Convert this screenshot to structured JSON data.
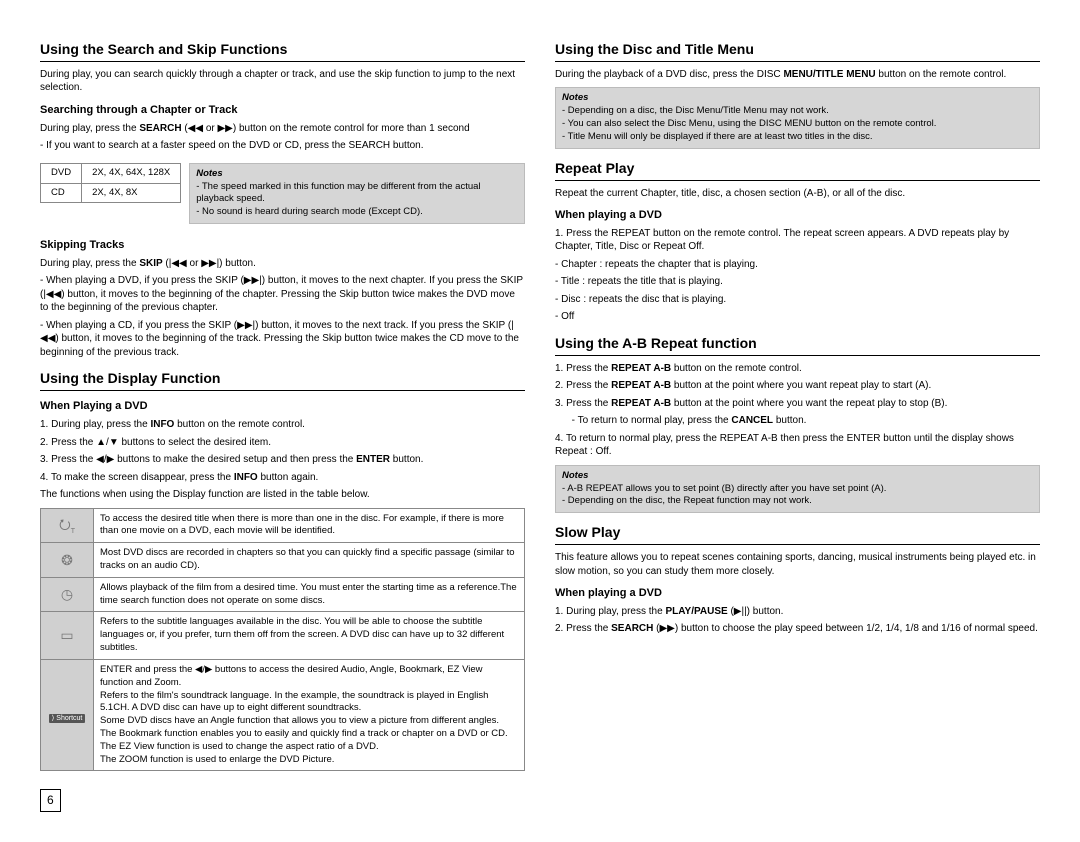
{
  "left": {
    "section1": {
      "title": "Using the Search and Skip Functions",
      "intro": "During play, you can search quickly through a chapter or track, and use the skip function to jump to the next selection.",
      "sub1": "Searching through a Chapter or Track",
      "sub1_p1a": "During play, press the ",
      "sub1_p1b": "SEARCH",
      "sub1_p1c": " (◀◀ or ▶▶) button on the remote control for more than 1 second",
      "sub1_p2": "- If you want to search at a faster speed on the DVD or CD, press the SEARCH button.",
      "speed_table": {
        "r1c1": "DVD",
        "r1c2": "2X, 4X, 64X, 128X",
        "r2c1": "CD",
        "r2c2": "2X, 4X, 8X"
      },
      "notes1": {
        "title": "Notes",
        "l1": "- The speed marked in this function may be different from the actual playback speed.",
        "l2": "- No sound is heard during search mode (Except CD)."
      },
      "sub2": "Skipping Tracks",
      "sub2_p1a": "During play, press the ",
      "sub2_p1b": "SKIP",
      "sub2_p1c": " (|◀◀ or ▶▶|) button.",
      "sub2_p2": "- When playing a DVD, if you press the SKIP (▶▶|) button, it moves to the next chapter. If you press the SKIP (|◀◀) button, it moves to the beginning of the chapter. Pressing the Skip button twice makes the DVD move to the beginning of the previous chapter.",
      "sub2_p3": "- When playing a CD, if you press the SKIP (▶▶|) button, it  moves to the next track. If you press the SKIP (|◀◀) button, it moves to the beginning of the track. Pressing the Skip button twice makes the CD move to the beginning of the previous track."
    },
    "section2": {
      "title": "Using the Display Function",
      "sub1": "When Playing a DVD",
      "l1a": "1. During play, press the ",
      "l1b": "INFO",
      "l1c": " button on the remote control.",
      "l2": "2. Press the ▲/▼ buttons to select the desired item.",
      "l3a": "3. Press the  ◀/▶ buttons to make the desired setup and then press the ",
      "l3b": "ENTER",
      "l3c": " button.",
      "l4a": "4. To make the screen disappear, press the ",
      "l4b": "INFO",
      "l4c": " button again.",
      "funcs_intro": "The functions when using the Display function are listed in the table below.",
      "table": {
        "r1": "To access the desired title when there is more than one in the disc. For example, if there is more than one movie on a DVD, each movie will be identified.",
        "r2": "Most DVD discs are recorded in chapters so that you can quickly find a specific passage (similar to tracks on an audio CD).",
        "r3": "Allows playback of the film from a desired time. You must enter the starting time as a reference.The time search function does not operate on some discs.",
        "r4": "Refers to the subtitle languages available in the disc. You will be able to choose the subtitle languages or, if you prefer, turn them off from the screen. A DVD disc can have up to 32 different subtitles.",
        "r5": "ENTER and press the  ◀/▶  buttons to access the desired Audio, Angle, Bookmark, EZ View function and Zoom.\nRefers to the film's soundtrack language. In the example, the soundtrack is played in English 5.1CH. A DVD disc can have up to eight different soundtracks.\nSome DVD discs have an Angle function that allows you to view a picture from different angles.\nThe Bookmark function enables you to easily and quickly find a track or chapter on a DVD or CD.\nThe EZ View function is used to change the aspect ratio of a DVD.\nThe ZOOM function is used to enlarge the DVD Picture."
      }
    }
  },
  "right": {
    "section1": {
      "title": "Using the Disc and Title Menu",
      "intro_a": "During the playback of a DVD disc, press the DISC ",
      "intro_b": "MENU/TITLE MENU",
      "intro_c": " button on the remote control.",
      "notes": {
        "title": "Notes",
        "l1": "- Depending on a disc, the Disc Menu/Title Menu may not work.",
        "l2": "- You can also select the Disc Menu, using the DISC MENU button on the remote control.",
        "l3": "- Title Menu will only be displayed if there are at least two titles in the disc."
      }
    },
    "section2": {
      "title": "Repeat  Play",
      "intro": "Repeat the current Chapter, title, disc, a chosen section (A-B), or all of the disc.",
      "sub1": "When playing a DVD",
      "l1": "1. Press the REPEAT button on the remote control. The repeat screen appears. A DVD repeats play by Chapter, Title, Disc or Repeat Off.",
      "l2": "- Chapter : repeats the chapter that is playing.",
      "l3": "- Title : repeats the title that is playing.",
      "l4": "- Disc : repeats the disc that is playing.",
      "l5": "- Off"
    },
    "section3": {
      "title": "Using the A-B Repeat function",
      "l1a": "1. Press the ",
      "l1b": "REPEAT A-B",
      "l1c": " button on the remote control.",
      "l2a": "2. Press the ",
      "l2b": "REPEAT A-B",
      "l2c": " button at the point where you want repeat play to start (A).",
      "l3a": "3. Press the ",
      "l3b": "REPEAT A-B",
      "l3c": " button at the point where you want the repeat play to stop (B).",
      "l3d": "      - To return to normal play, press the ",
      "l3e": "CANCEL",
      "l3f": " button.",
      "l4": "4. To return to normal play, press the REPEAT A-B then press the ENTER button until the display shows Repeat : Off.",
      "notes": {
        "title": "Notes",
        "l1": "- A-B REPEAT allows you to set point (B) directly after you have set point (A).",
        "l2": "- Depending on the disc, the Repeat function may not work."
      }
    },
    "section4": {
      "title": "Slow Play",
      "intro": "This feature allows you to repeat scenes containing sports, dancing, musical instruments being played etc. in slow motion, so you can study them more closely.",
      "sub1": "When playing a DVD",
      "l1a": "1. During play, press the ",
      "l1b": "PLAY/PAUSE",
      "l1c": " (▶||) button.",
      "l2a": "2. Press the ",
      "l2b": "SEARCH",
      "l2c": " (▶▶) button to choose the play speed between 1/2, 1/4, 1/8 and 1/16 of normal speed."
    }
  },
  "page_number": "6"
}
